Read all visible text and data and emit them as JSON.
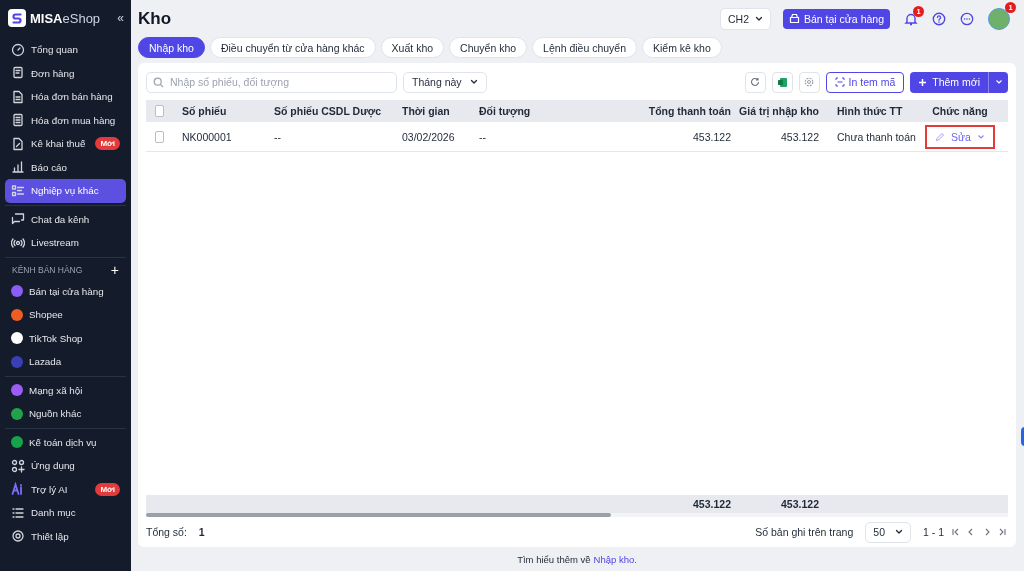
{
  "sidebar": {
    "logo": "MISA",
    "logo_suffix": "eShop",
    "collapse": "«",
    "groups": [
      {
        "items": [
          {
            "label": "Tổng quan",
            "selected": false
          },
          {
            "label": "Đơn hàng",
            "selected": false
          },
          {
            "label": "Hóa đơn bán hàng",
            "selected": false
          },
          {
            "label": "Hóa đơn mua hàng",
            "selected": false
          },
          {
            "label": "Kê khai thuế",
            "selected": false,
            "badge": "Mới"
          },
          {
            "label": "Báo cáo",
            "selected": false
          },
          {
            "label": "Nghiệp vụ khác",
            "selected": true
          }
        ]
      },
      {
        "items": [
          {
            "label": "Chat đa kênh",
            "selected": false
          },
          {
            "label": "Livestream",
            "selected": false
          }
        ]
      },
      {
        "title": "KÊNH BÁN HÀNG",
        "add": "+",
        "items": [
          {
            "label": "Bán tại cửa hàng",
            "selected": false,
            "color": "#8b5cf6"
          },
          {
            "label": "Shopee",
            "selected": false,
            "color": "#f05d23"
          },
          {
            "label": "TikTok Shop",
            "selected": false,
            "color": "#ffffff"
          },
          {
            "label": "Lazada",
            "selected": false,
            "color": "#3b3fb6"
          }
        ]
      },
      {
        "items": [
          {
            "label": "Mạng xã hội",
            "selected": false,
            "color": "#9b5cf6"
          },
          {
            "label": "Nguồn khác",
            "selected": false,
            "color": "#22a34a"
          }
        ]
      },
      {
        "items": [
          {
            "label": "Kế toán dịch vụ",
            "selected": false,
            "color": "#16a34a"
          },
          {
            "label": "Ứng dụng",
            "selected": false
          },
          {
            "label": "Trợ lý AI",
            "selected": false,
            "badge": "Mới"
          },
          {
            "label": "Danh mục",
            "selected": false
          },
          {
            "label": "Thiết lập",
            "selected": false
          }
        ]
      }
    ]
  },
  "header": {
    "title": "Kho",
    "branch": "CH2",
    "store_button": "Bán tại cửa hàng",
    "notification_count": "1",
    "avatar_badge": "1"
  },
  "tabs": [
    {
      "label": "Nhập kho",
      "selected": true
    },
    {
      "label": "Điều chuyển từ cửa hàng khác",
      "selected": false
    },
    {
      "label": "Xuất kho",
      "selected": false
    },
    {
      "label": "Chuyển kho",
      "selected": false
    },
    {
      "label": "Lệnh điều chuyển",
      "selected": false
    },
    {
      "label": "Kiểm kê kho",
      "selected": false
    }
  ],
  "toolbar": {
    "search": {
      "placeholder": "Nhập số phiếu, đối tượng"
    },
    "period": "Tháng này",
    "print_button": "In tem mã",
    "add_button": "Thêm mới"
  },
  "table": {
    "all_checked": false,
    "columns": [
      "Số phiếu",
      "Số phiếu CSDL Dược",
      "Thời gian",
      "Đối tượng",
      "Tổng thanh toán",
      "Giá trị nhập kho",
      "Hình thức TT",
      "Chức năng"
    ],
    "rows": [
      {
        "checked": false,
        "cells": [
          "NK000001",
          "--",
          "03/02/2026",
          "--",
          "453.122",
          "453.122",
          "Chưa thanh toán"
        ],
        "action": "Sửa",
        "highlighted": true
      }
    ],
    "totals": {
      "payment_total": "453.122",
      "stock_value_total": "453.122"
    }
  },
  "pager": {
    "total_label": "Tổng số:",
    "total": "1",
    "per_page_label": "Số bản ghi trên trang",
    "per_page": "50",
    "range": "1 - 1"
  },
  "help": {
    "text": "Tìm hiểu thêm về",
    "link": "Nhập kho."
  }
}
